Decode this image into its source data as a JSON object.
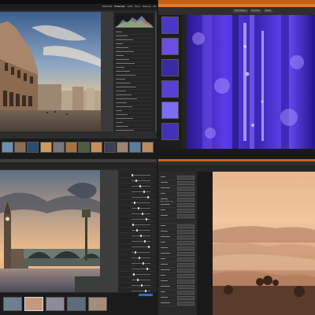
{
  "accent_orange": "#e36a1e",
  "tl": {
    "module_tabs": [
      "Bibliothek",
      "Entwickeln",
      "Karte",
      "Buch",
      "Diashow",
      "Drucken",
      "Web"
    ],
    "histogram_label": "Histogramm",
    "filmstrip_count": 12
  },
  "tr": {
    "buttons": [
      "Exportieren",
      "Drucken",
      "Teilen"
    ],
    "thumbs": 6
  },
  "bl": {
    "filmstrip_count": 5
  },
  "br": {
    "section_label": "Belichtung",
    "panel_rows": 24
  }
}
